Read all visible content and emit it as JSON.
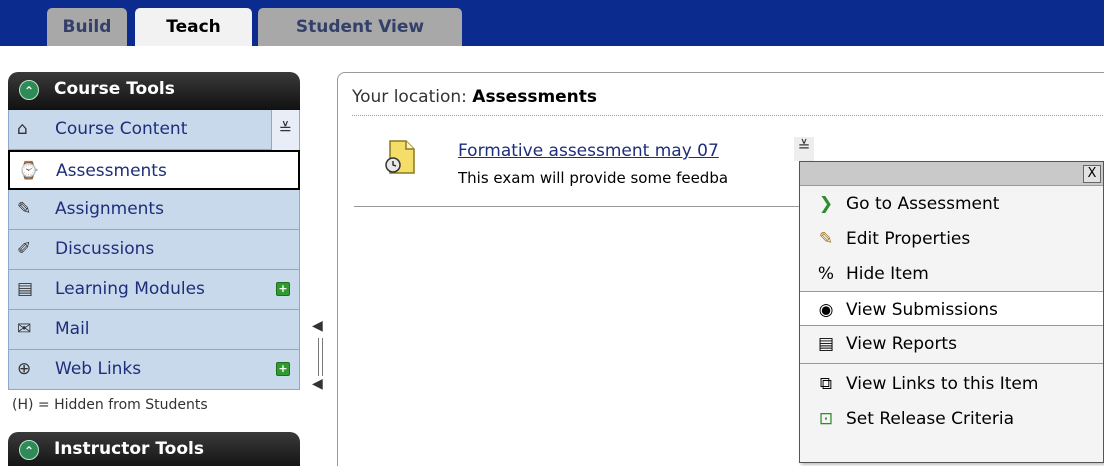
{
  "tabs": [
    {
      "label": "Build"
    },
    {
      "label": "Teach"
    },
    {
      "label": "Student View"
    }
  ],
  "sidebar": {
    "course_tools_title": "Course Tools",
    "items": [
      {
        "label": "Course Content",
        "icon": "house-icon"
      },
      {
        "label": "Assessments",
        "icon": "clock-document-icon"
      },
      {
        "label": "Assignments",
        "icon": "pen-document-icon"
      },
      {
        "label": "Discussions",
        "icon": "pin-icon"
      },
      {
        "label": "Learning Modules",
        "icon": "document-icon"
      },
      {
        "label": "Mail",
        "icon": "envelope-icon"
      },
      {
        "label": "Web Links",
        "icon": "globe-document-icon"
      }
    ],
    "hidden_note": "(H) = Hidden from Students",
    "instructor_tools_title": "Instructor Tools"
  },
  "main": {
    "location_prefix": "Your location: ",
    "location_current": "Assessments",
    "item": {
      "title": "Formative assessment may 07",
      "description": "This exam will provide some feedba"
    }
  },
  "context_menu": {
    "close_label": "X",
    "items": [
      {
        "label": "Go to Assessment",
        "icon": "arrow-right-icon"
      },
      {
        "label": "Edit Properties",
        "icon": "pencil-icon"
      },
      {
        "label": "Hide Item",
        "icon": "hide-icon"
      },
      {
        "label": "View Submissions",
        "icon": "eye-document-icon"
      },
      {
        "label": "View Reports",
        "icon": "report-icon"
      },
      {
        "label": "View Links to this Item",
        "icon": "links-icon"
      },
      {
        "label": "Set Release Criteria",
        "icon": "release-criteria-icon"
      }
    ]
  },
  "colors": {
    "top_bar": "#0b2c8e",
    "sidebar_item_bg": "#c9d9ec",
    "link_text": "#1d2e7a",
    "plus_badge": "#2d9b2d"
  }
}
